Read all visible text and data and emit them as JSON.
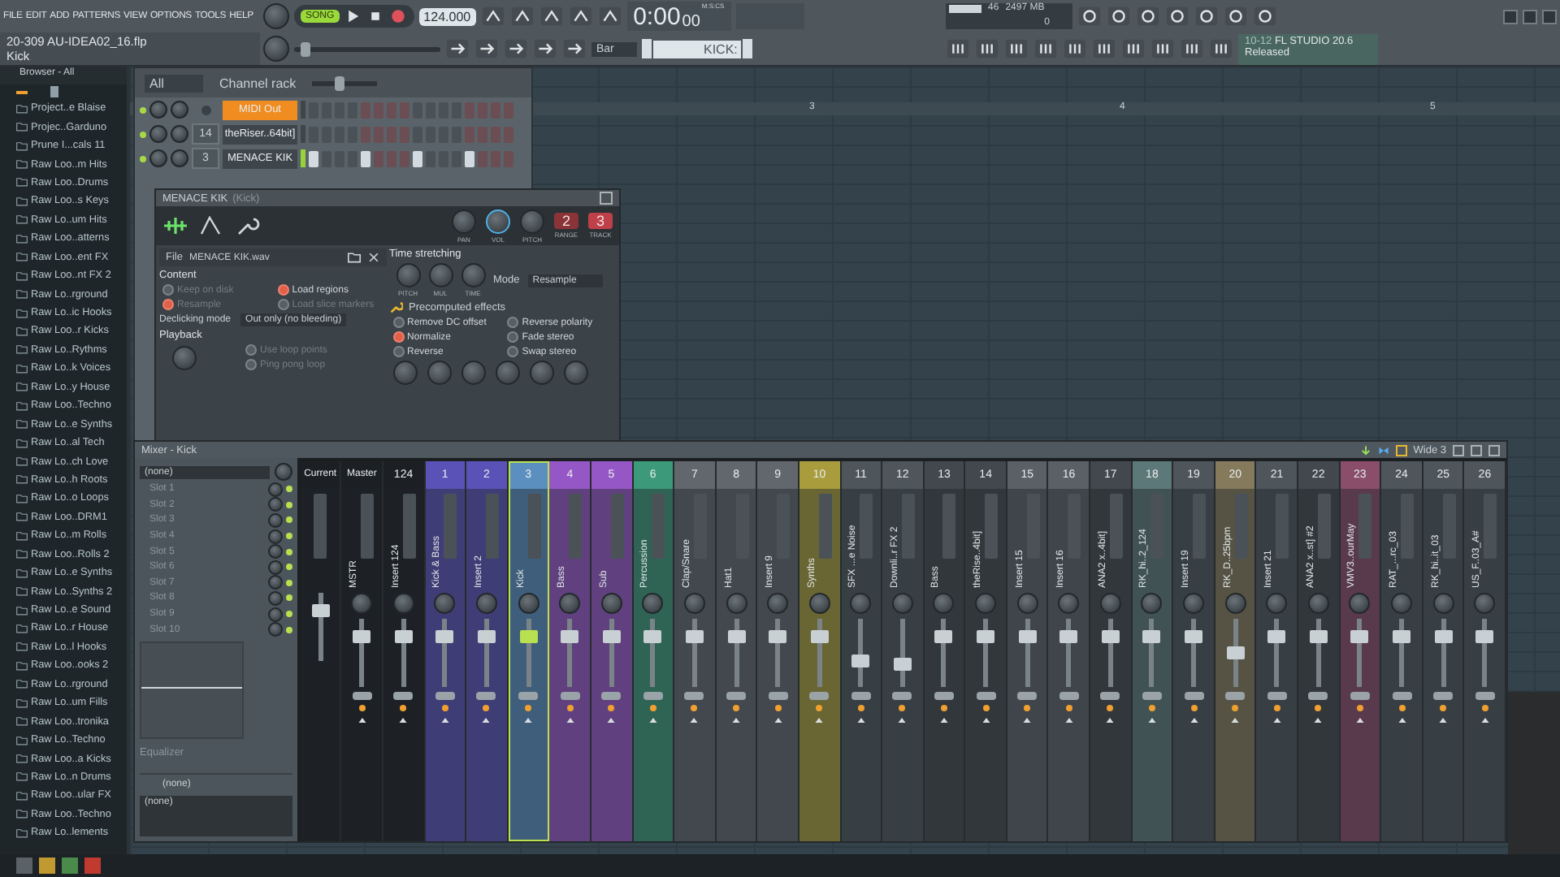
{
  "toolbar": {
    "menus": [
      "FILE",
      "EDIT",
      "ADD",
      "PATTERNS",
      "VIEW",
      "OPTIONS",
      "TOOLS",
      "HELP"
    ],
    "mode": "SONG",
    "tempo": "124.000",
    "project": "20-309 AU-IDEA02_16.flp",
    "hint": "Kick",
    "time": "0:00",
    "time_cs": "00",
    "time_unit": "M:S:CS",
    "cpu": "46",
    "memory": "2497 MB",
    "polyphony": "0",
    "snap": "Bar",
    "pattern": "KICK:",
    "news_date": "10-12",
    "news_title": "FL STUDIO 20.6",
    "news_status": "Released",
    "slider": {
      "level": 0.05
    }
  },
  "browser": {
    "title": "Browser - All",
    "items": [
      "Project..e Blaise",
      "Projec..Garduno",
      "Prune I...cals 11",
      "Raw Loo..m Hits",
      "Raw Loo..Drums",
      "Raw Loo..s Keys",
      "Raw Lo..um Hits",
      "Raw Loo..atterns",
      "Raw Loo..ent FX",
      "Raw Loo..nt FX 2",
      "Raw Lo..rground",
      "Raw Lo..ic Hooks",
      "Raw Loo..r Kicks",
      "Raw Lo..Rythms",
      "Raw Lo..k Voices",
      "Raw Lo..y House",
      "Raw Loo..Techno",
      "Raw Lo..e Synths",
      "Raw Lo..al Tech",
      "Raw Lo..ch Love",
      "Raw Lo..h Roots",
      "Raw Lo..o Loops",
      "Raw Loo..DRM1",
      "Raw Lo..m Rolls",
      "Raw Loo..Rolls 2",
      "Raw Lo..e Synths",
      "Raw Lo..Synths 2",
      "Raw Lo..e Sound",
      "Raw Lo..r House",
      "Raw Lo..l Hooks",
      "Raw Loo..ooks 2",
      "Raw Lo..rground",
      "Raw Lo..um Fills",
      "Raw Loo..tronika",
      "Raw Lo..Techno",
      "Raw Loo..a Kicks",
      "Raw Lo..n Drums",
      "Raw Loo..ular FX",
      "Raw Loo..Techno",
      "Raw Lo..lements"
    ]
  },
  "playlist": {
    "bars": [
      "3",
      "4",
      "5"
    ]
  },
  "channel_rack": {
    "filter": "All",
    "title": "Channel rack",
    "swing": {
      "level": 0.4
    },
    "channels": [
      {
        "name": "MIDI Out",
        "kind": "midi",
        "selected": false,
        "steps": [
          false,
          false,
          false,
          false,
          false,
          false,
          false,
          false,
          false,
          false,
          false,
          false,
          false,
          false,
          false,
          false
        ]
      },
      {
        "name": "theRiser..64bit]",
        "kind": "sample",
        "route": "14",
        "selected": false,
        "steps": [
          false,
          false,
          false,
          false,
          false,
          false,
          false,
          false,
          false,
          false,
          false,
          false,
          false,
          false,
          false,
          false
        ]
      },
      {
        "name": "MENACE KIK",
        "kind": "sample",
        "route": "3",
        "selected": true,
        "steps": [
          true,
          false,
          false,
          false,
          true,
          false,
          false,
          false,
          true,
          false,
          false,
          false,
          true,
          false,
          false,
          false
        ]
      }
    ]
  },
  "sampler": {
    "title": "MENACE KIK",
    "subtitle": "(Kick)",
    "knobs": [
      "PAN",
      "VOL",
      "PITCH"
    ],
    "range": "2",
    "range_label": "RANGE",
    "track": "3",
    "track_label": "TRACK",
    "file_label": "File",
    "file": "MENACE KIK.wav",
    "content_title": "Content",
    "content": [
      {
        "label": "Keep on disk",
        "on": false,
        "disabled": true
      },
      {
        "label": "Load regions",
        "on": true,
        "disabled": false
      },
      {
        "label": "Resample",
        "on": true,
        "disabled": true
      },
      {
        "label": "Load slice markers",
        "on": false,
        "disabled": true
      }
    ],
    "declick_label": "Declicking mode",
    "declick": "Out only (no bleeding)",
    "playback_title": "Playback",
    "playback": [
      {
        "label": "Use loop points",
        "on": false,
        "disabled": true
      },
      {
        "label": "Ping pong loop",
        "on": false,
        "disabled": true
      }
    ],
    "stretch_title": "Time stretching",
    "stretch_knobs": [
      "PITCH",
      "MUL",
      "TIME"
    ],
    "mode_label": "Mode",
    "mode": "Resample",
    "effects_title": "Precomputed effects",
    "effects": [
      {
        "label": "Remove DC offset",
        "on": false
      },
      {
        "label": "Reverse polarity",
        "on": false
      },
      {
        "label": "Normalize",
        "on": true
      },
      {
        "label": "Fade stereo",
        "on": false
      },
      {
        "label": "Reverse",
        "on": false
      },
      {
        "label": "Swap stereo",
        "on": false
      }
    ]
  },
  "mixer": {
    "title": "Mixer - Kick",
    "preset": "Wide 3",
    "input": "(none)",
    "slots": [
      {
        "name": "Slot 1",
        "on": true
      },
      {
        "name": "Slot 2",
        "on": true
      },
      {
        "name": "Slot 3",
        "on": true
      },
      {
        "name": "Slot 4",
        "on": true
      },
      {
        "name": "Slot 5",
        "on": true
      },
      {
        "name": "Slot 6",
        "on": true
      },
      {
        "name": "Slot 7",
        "on": true
      },
      {
        "name": "Slot 8",
        "on": true
      },
      {
        "name": "Slot 9",
        "on": true
      },
      {
        "name": "Slot 10",
        "on": true
      }
    ],
    "eq_label": "Equalizer",
    "output_top": "(none)",
    "output_bottom": "(none)",
    "tracks": [
      {
        "kind": "current",
        "number": "Current",
        "color": "#1c2024",
        "selected": false,
        "level": 0.8
      },
      {
        "kind": "master",
        "number": "Master",
        "name": "MSTR",
        "color": "#1c2024",
        "selected": false,
        "level": 0.8
      },
      {
        "kind": "insert",
        "number": "124",
        "name": "Insert 124",
        "color": "#1c2024",
        "selected": false,
        "level": 0.8
      },
      {
        "kind": "insert",
        "number": "1",
        "name": "Kick & Bass",
        "color": "#5a52b6",
        "selected": false,
        "level": 0.8
      },
      {
        "kind": "insert",
        "number": "2",
        "name": "Insert 2",
        "color": "#5a52b6",
        "selected": false,
        "level": 0.8
      },
      {
        "kind": "insert",
        "number": "3",
        "name": "Kick",
        "color": "#5a8fc0",
        "selected": true,
        "level": 0.8
      },
      {
        "kind": "insert",
        "number": "4",
        "name": "Bass",
        "color": "#9657c6",
        "selected": false,
        "level": 0.8
      },
      {
        "kind": "insert",
        "number": "5",
        "name": "Sub",
        "color": "#9657c6",
        "selected": false,
        "level": 0.8
      },
      {
        "kind": "insert",
        "number": "6",
        "name": "Percussion",
        "color": "#3c9a7a",
        "selected": false,
        "level": 0.8
      },
      {
        "kind": "insert",
        "number": "7",
        "name": "Clap/Snare",
        "color": "#61676d",
        "selected": false,
        "level": 0.8
      },
      {
        "kind": "insert",
        "number": "8",
        "name": "Hat1",
        "color": "#61676d",
        "selected": false,
        "level": 0.8
      },
      {
        "kind": "insert",
        "number": "9",
        "name": "Insert 9",
        "color": "#61676d",
        "selected": false,
        "level": 0.8
      },
      {
        "kind": "insert",
        "number": "10",
        "name": "Synths",
        "color": "#a89c3c",
        "selected": false,
        "level": 0.8
      },
      {
        "kind": "insert",
        "number": "11",
        "name": "SFX ...e Noise",
        "color": "#4e555b",
        "selected": false,
        "level": 0.35
      },
      {
        "kind": "insert",
        "number": "12",
        "name": "Downli..r FX 2",
        "color": "#4e555b",
        "selected": false,
        "level": 0.3
      },
      {
        "kind": "insert",
        "number": "13",
        "name": "Bass",
        "color": "#42484e",
        "selected": false,
        "level": 0.8
      },
      {
        "kind": "insert",
        "number": "14",
        "name": "theRise..4bit]",
        "color": "#42484e",
        "selected": false,
        "level": 0.8
      },
      {
        "kind": "insert",
        "number": "15",
        "name": "Insert 15",
        "color": "#5a6066",
        "selected": false,
        "level": 0.8
      },
      {
        "kind": "insert",
        "number": "16",
        "name": "Insert 16",
        "color": "#5a6066",
        "selected": false,
        "level": 0.8
      },
      {
        "kind": "insert",
        "number": "17",
        "name": "ANA2 x..4bit]",
        "color": "#42484e",
        "selected": false,
        "level": 0.8
      },
      {
        "kind": "insert",
        "number": "18",
        "name": "RK_hi..2_124",
        "color": "#5d7878",
        "selected": false,
        "level": 0.8
      },
      {
        "kind": "insert",
        "number": "19",
        "name": "Insert 19",
        "color": "#4e555b",
        "selected": false,
        "level": 0.8
      },
      {
        "kind": "insert",
        "number": "20",
        "name": "RK_D..25bpm",
        "color": "#857a5c",
        "selected": false,
        "level": 0.5
      },
      {
        "kind": "insert",
        "number": "21",
        "name": "Insert 21",
        "color": "#4e555b",
        "selected": false,
        "level": 0.8
      },
      {
        "kind": "insert",
        "number": "22",
        "name": "ANA2 x..st] #2",
        "color": "#42484e",
        "selected": false,
        "level": 0.8
      },
      {
        "kind": "insert",
        "number": "23",
        "name": "VMV3..ourMay",
        "color": "#8a4d6a",
        "selected": false,
        "level": 0.8
      },
      {
        "kind": "insert",
        "number": "24",
        "name": "RAT_...rc_03",
        "color": "#4e555b",
        "selected": false,
        "level": 0.8
      },
      {
        "kind": "insert",
        "number": "25",
        "name": "RK_hi..it_03",
        "color": "#4e555b",
        "selected": false,
        "level": 0.8
      },
      {
        "kind": "insert",
        "number": "26",
        "name": "US_F..03_A#",
        "color": "#4e555b",
        "selected": false,
        "level": 0.8
      }
    ]
  }
}
